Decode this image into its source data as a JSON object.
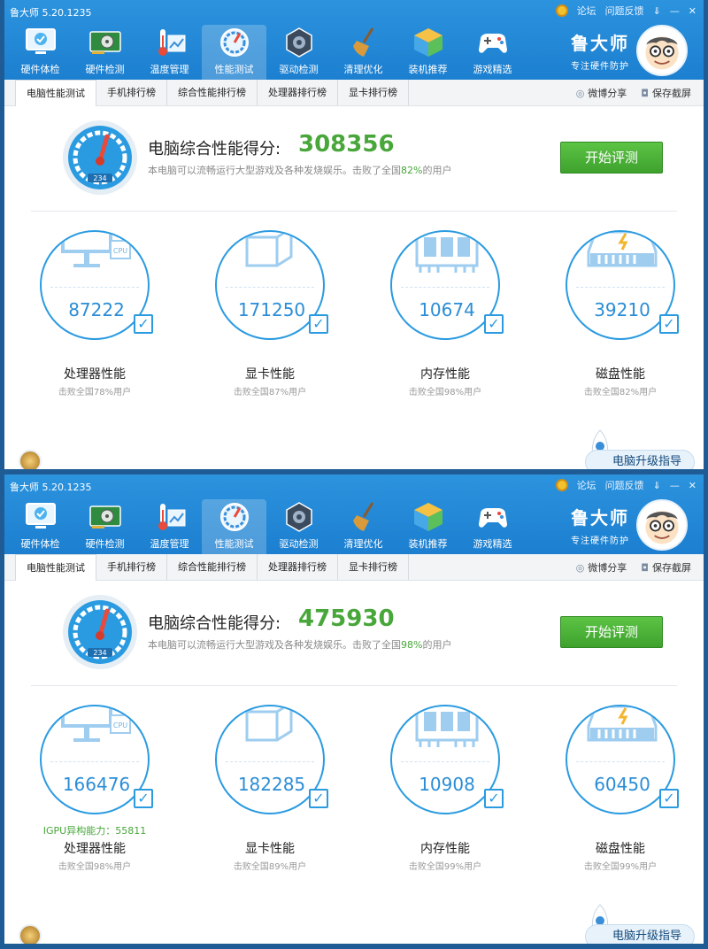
{
  "app": {
    "title": "鲁大师 5.20.1235",
    "ctrl_forum": "论坛",
    "ctrl_feedback": "问题反馈",
    "ctrl_menu": "⇓",
    "ctrl_min": "—",
    "ctrl_close": "✕",
    "nav": [
      {
        "label": "硬件体检",
        "icon": "monitor-check-icon"
      },
      {
        "label": "硬件检测",
        "icon": "graphics-card-icon"
      },
      {
        "label": "温度管理",
        "icon": "thermometer-icon"
      },
      {
        "label": "性能测试",
        "icon": "speedometer-icon"
      },
      {
        "label": "驱动检测",
        "icon": "driver-gear-icon"
      },
      {
        "label": "清理优化",
        "icon": "broom-icon"
      },
      {
        "label": "装机推荐",
        "icon": "cube-icon"
      },
      {
        "label": "游戏精选",
        "icon": "gamepad-icon"
      }
    ],
    "brand_name": "鲁大师",
    "brand_slogan": "专注硬件防护",
    "tabs": [
      "电脑性能测试",
      "手机排行榜",
      "综合性能排行榜",
      "处理器排行榜",
      "显卡排行榜"
    ],
    "share": "微博分享",
    "screenshot": "保存截屏",
    "score_label": "电脑综合性能得分:",
    "desc_prefix": "本电脑可以流畅运行大型游戏及各种发烧娱乐。击败了全国",
    "desc_suffix": "的用户",
    "start_button": "开始评测",
    "upgrade": "电脑升级指导",
    "card_labels": [
      "处理器性能",
      "显卡性能",
      "内存性能",
      "磁盘性能"
    ],
    "gauge_digits": "234",
    "cpu_chip": "CPU"
  },
  "windows": [
    {
      "score": "308356",
      "beat_pct": "82%",
      "cards": [
        {
          "value": "87222",
          "sub": "击败全国78%用户"
        },
        {
          "value": "171250",
          "sub": "击败全国87%用户"
        },
        {
          "value": "10674",
          "sub": "击败全国98%用户"
        },
        {
          "value": "39210",
          "sub": "击败全国82%用户"
        }
      ]
    },
    {
      "score": "475930",
      "beat_pct": "98%",
      "igpu": "IGPU异构能力：55811",
      "cards": [
        {
          "value": "166476",
          "sub": "击败全国98%用户"
        },
        {
          "value": "182285",
          "sub": "击败全国89%用户"
        },
        {
          "value": "10908",
          "sub": "击败全国99%用户"
        },
        {
          "value": "60450",
          "sub": "击败全国99%用户"
        }
      ]
    }
  ],
  "colors": {
    "header_blue": "#2c93de",
    "accent_green": "#48a63a",
    "circle_blue": "#2b9be1"
  }
}
